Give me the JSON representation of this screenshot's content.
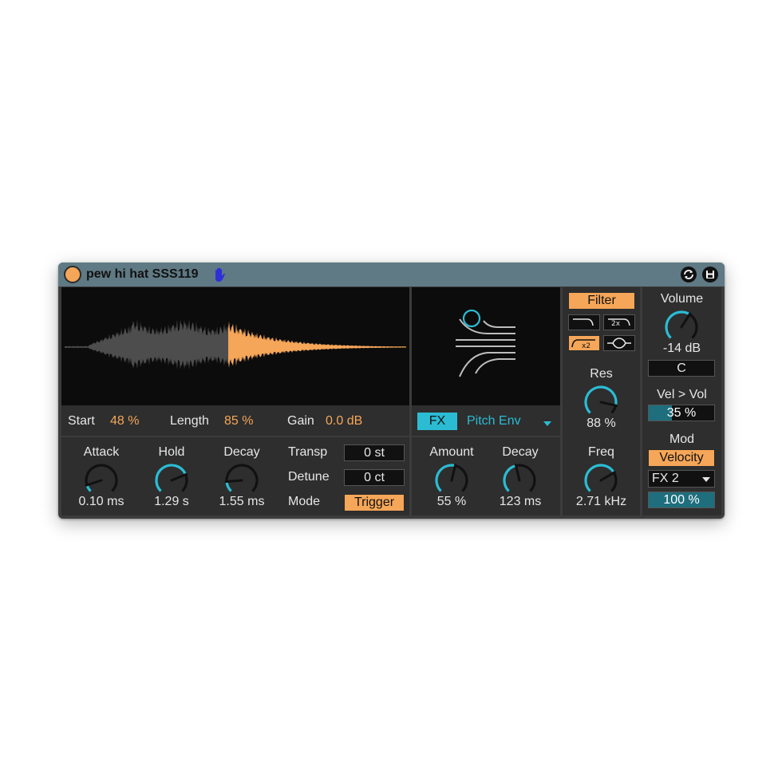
{
  "device": {
    "title": "pew hi hat SSS119",
    "icons": {
      "power": "power-icon",
      "hand": "hand-icon",
      "hot_swap": "hot-swap-icon",
      "save": "save-icon"
    }
  },
  "sample": {
    "start_label": "Start",
    "start_value": "48 %",
    "length_label": "Length",
    "length_value": "85 %",
    "gain_label": "Gain",
    "gain_value": "0.0 dB"
  },
  "envelope": {
    "attack_label": "Attack",
    "attack_value": "0.10 ms",
    "attack_level": 0.1,
    "hold_label": "Hold",
    "hold_value": "1.29 s",
    "hold_level": 0.75,
    "decay_label": "Decay",
    "decay_value": "1.55 ms",
    "decay_level": 0.15
  },
  "pitch": {
    "transp_label": "Transp",
    "transp_value": "0 st",
    "detune_label": "Detune",
    "detune_value": "0 ct",
    "mode_label": "Mode",
    "mode_value": "Trigger"
  },
  "fx": {
    "fx_button": "FX",
    "selector": "Pitch Env",
    "amount_label": "Amount",
    "amount_value": "55 %",
    "amount_level": 0.55,
    "decay_label": "Decay",
    "decay_value": "123 ms",
    "decay_level": 0.45
  },
  "filter": {
    "button": "Filter",
    "types": [
      "lowpass",
      "lowpass x2",
      "highpass x2",
      "bandpass"
    ],
    "res_label": "Res",
    "res_value": "88 %",
    "res_level": 0.88,
    "freq_label": "Freq",
    "freq_value": "2.71 kHz",
    "freq_level": 0.72
  },
  "output": {
    "volume_label": "Volume",
    "volume_value": "-14 dB",
    "volume_level": 0.62,
    "pan_value": "C",
    "vel_vol_label": "Vel > Vol",
    "vel_vol_value": "35 %",
    "vel_vol_level": 0.35,
    "mod_label": "Mod",
    "mod_source": "Velocity",
    "mod_target": "FX 2",
    "mod_amount": "100 %",
    "mod_amount_level": 1.0
  },
  "colors": {
    "accent_orange": "#f5a658",
    "accent_cyan": "#2bbcd4",
    "titlebar": "#5f7a84",
    "panel": "#2e2e2e",
    "waveform_inactive": "#4d4d4d"
  }
}
